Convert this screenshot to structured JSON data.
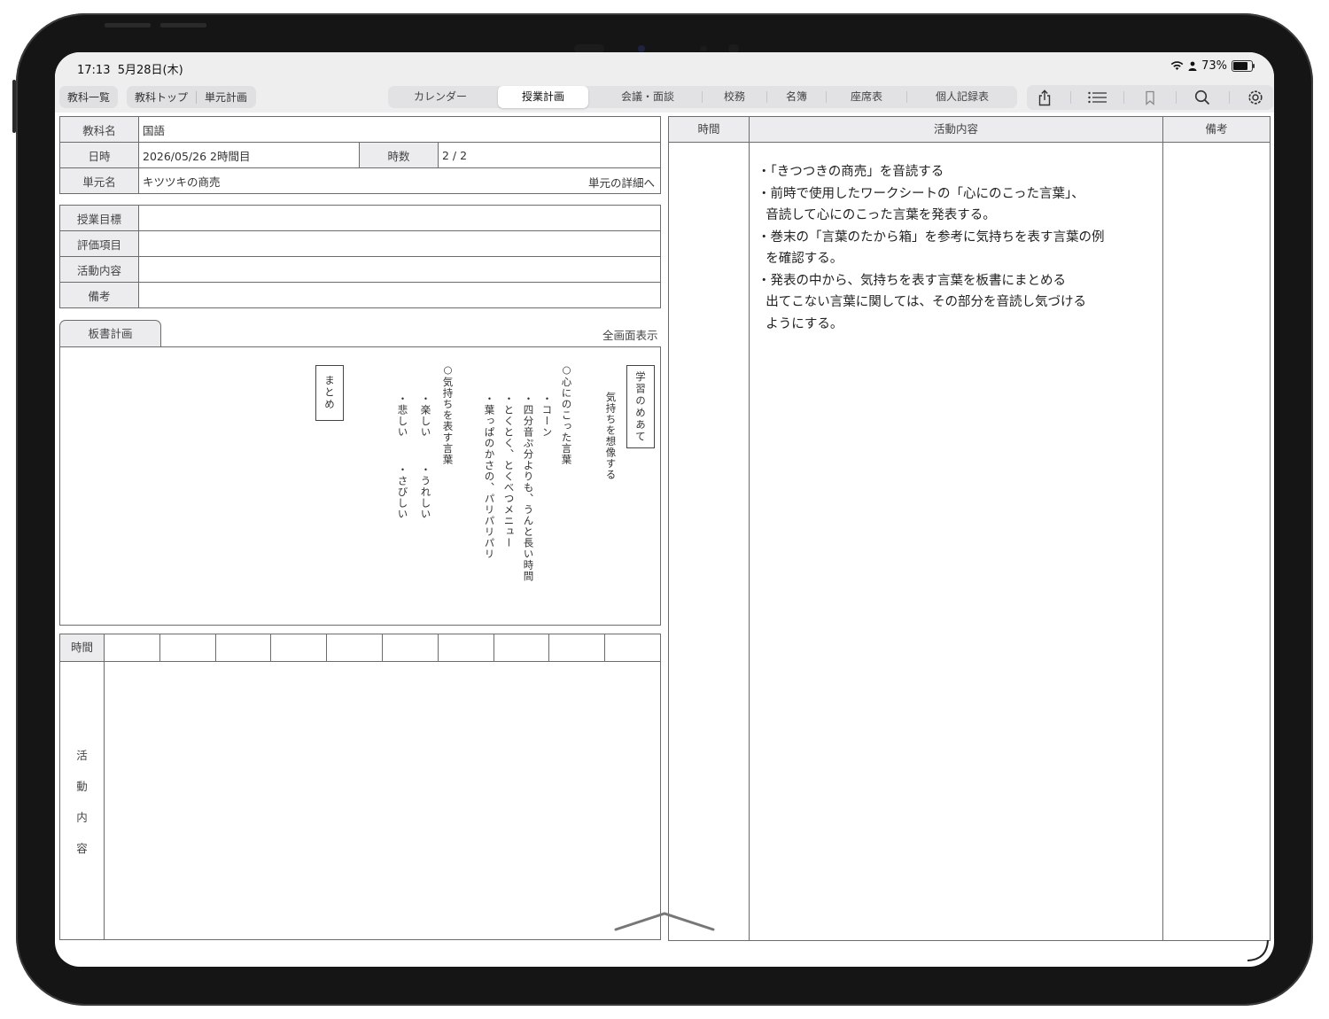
{
  "status": {
    "time": "17:13",
    "date": "5月28日(木)",
    "battery_text": "73%",
    "battery_level": 0.73
  },
  "toolbar": {
    "subject_list": "教科一覧",
    "subject_top": "教科トップ",
    "unit_plan": "単元計画",
    "tabs": [
      {
        "label": "カレンダー"
      },
      {
        "label": "授業計画",
        "active": true
      },
      {
        "label": "会議・面談"
      },
      {
        "label": "校務"
      },
      {
        "label": "名簿"
      },
      {
        "label": "座席表"
      },
      {
        "label": "個人記録表"
      }
    ],
    "icons": [
      "share-icon",
      "list-icon",
      "bookmark-icon",
      "search-icon",
      "gear-icon"
    ]
  },
  "lesson": {
    "subject_label": "教科名",
    "subject_value": "国語",
    "date_label": "日時",
    "date_value": "2026/05/26 2時間目",
    "count_label": "時数",
    "count_value": "2 / 2",
    "unit_label": "単元名",
    "unit_value": "キツツキの商売",
    "unit_detail": "単元の詳細へ"
  },
  "plan_rows": {
    "goal_label": "授業目標",
    "eval_label": "評価項目",
    "activity_label": "活動内容",
    "note_label": "備考"
  },
  "board": {
    "tab_label": "板書計画",
    "fullscreen_label": "全画面表示",
    "goal_box": "学習のめあて",
    "goal_text": "気持ちを想像する",
    "col1": "○心にのこった言葉",
    "col2": "・コーン",
    "col3": "・四分音ぷ分よりも、うんと長い時間",
    "col4": "・とくとく、とくべつメニュー",
    "col5": "・葉っぱのかさの、パリパリパリ",
    "col6": "○気持ちを表す言葉",
    "col7a": "・楽しい",
    "col7b": "・うれしい",
    "col8a": "・悲しい",
    "col8b": "・さびしい",
    "summary_box": "まとめ"
  },
  "timetable": {
    "time_label": "時間",
    "activity_chars": [
      "活",
      "動",
      "内",
      "容"
    ]
  },
  "right_panel": {
    "col_time": "時間",
    "col_activity": "活動内容",
    "col_note": "備考",
    "lines": [
      "・「きつつきの商売」を音読する",
      "・前時で使用したワークシートの「心にのこった言葉」、",
      "  音読して心にのこった言葉を発表する。",
      "",
      "・巻末の「言葉のたから箱」を参考に気持ちを表す言葉の例",
      "  を確認する。",
      "・発表の中から、気持ちを表す言葉を板書にまとめる",
      "  出てこない言葉に関しては、その部分を音読し気づける",
      "  ようにする。"
    ]
  }
}
